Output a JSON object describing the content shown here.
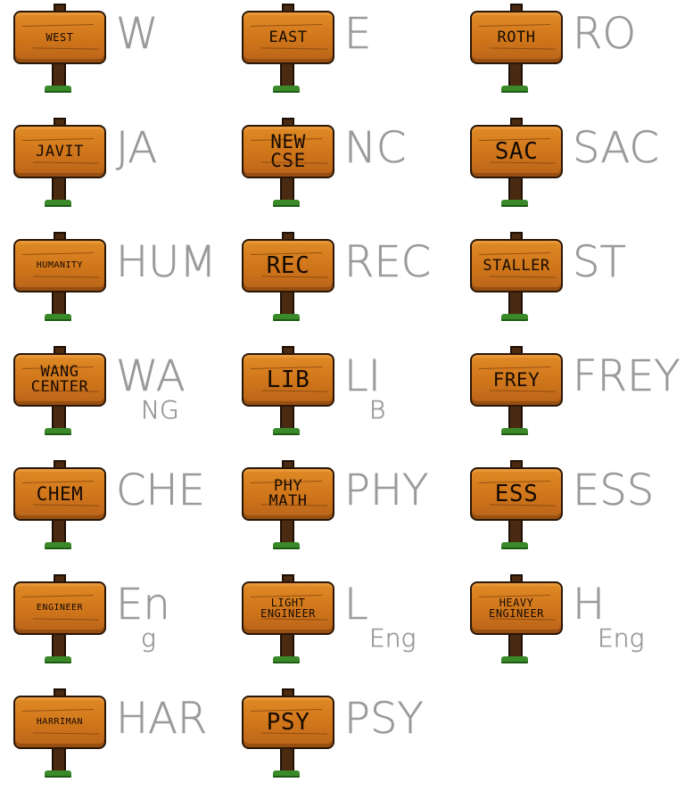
{
  "signs": [
    {
      "label": [
        "WEST"
      ],
      "size": "size-s",
      "scrawl": [
        "W"
      ]
    },
    {
      "label": [
        "EAST"
      ],
      "size": "size-m",
      "scrawl": [
        "E"
      ]
    },
    {
      "label": [
        "ROTH"
      ],
      "size": "size-m",
      "scrawl": [
        "RO"
      ]
    },
    {
      "label": [
        "JAVIT"
      ],
      "size": "size-m",
      "scrawl": [
        "JA"
      ]
    },
    {
      "label": [
        "NEW",
        "CSE"
      ],
      "size": "size-l",
      "scrawl": [
        "NC"
      ]
    },
    {
      "label": [
        "SAC"
      ],
      "size": "size-xl",
      "scrawl": [
        "SAC"
      ]
    },
    {
      "label": [
        "HUMANITY"
      ],
      "size": "size-xs",
      "scrawl": [
        "HUM"
      ]
    },
    {
      "label": [
        "REC"
      ],
      "size": "size-xl",
      "scrawl": [
        "REC"
      ]
    },
    {
      "label": [
        "STALLER"
      ],
      "size": "size-m",
      "scrawl": [
        "ST"
      ]
    },
    {
      "label": [
        "WANG",
        "CENTER"
      ],
      "size": "size-m",
      "scrawl": [
        "WA",
        "NG"
      ]
    },
    {
      "label": [
        "LIB"
      ],
      "size": "size-xl",
      "scrawl": [
        "LI",
        "B"
      ]
    },
    {
      "label": [
        "FREY"
      ],
      "size": "size-l",
      "scrawl": [
        "FREY"
      ]
    },
    {
      "label": [
        "CHEM"
      ],
      "size": "size-l",
      "scrawl": [
        "CHE"
      ]
    },
    {
      "label": [
        "PHY",
        "MATH"
      ],
      "size": "size-m",
      "scrawl": [
        "PHY"
      ]
    },
    {
      "label": [
        "ESS"
      ],
      "size": "size-xl",
      "scrawl": [
        "ESS"
      ]
    },
    {
      "label": [
        "ENGINEER"
      ],
      "size": "size-xs",
      "scrawl": [
        "En",
        "g"
      ]
    },
    {
      "label": [
        "LIGHT",
        "ENGINEER"
      ],
      "size": "size-s",
      "scrawl": [
        "L",
        "Eng"
      ]
    },
    {
      "label": [
        "HEAVY",
        "ENGINEER"
      ],
      "size": "size-s",
      "scrawl": [
        "H",
        "Eng"
      ]
    },
    {
      "label": [
        "HARRIMAN"
      ],
      "size": "size-xs",
      "scrawl": [
        "HAR"
      ]
    },
    {
      "label": [
        "PSY"
      ],
      "size": "size-xl",
      "scrawl": [
        "PSY"
      ]
    }
  ],
  "colors": {
    "board": "#cf751a",
    "board_outline": "#2a1606",
    "post": "#4a2a10",
    "grass": "#3a8a2a",
    "scrawl": "#9a9a9a",
    "background": "#ffffff"
  }
}
